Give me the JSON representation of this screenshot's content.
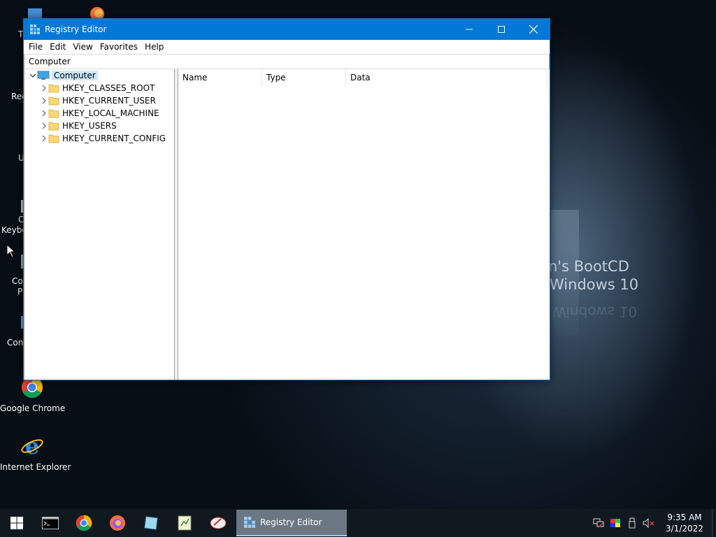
{
  "window": {
    "title": "Registry Editor",
    "menu": [
      "File",
      "Edit",
      "View",
      "Favorites",
      "Help"
    ],
    "address": "Computer",
    "tree": {
      "root": "Computer",
      "children": [
        "HKEY_CLASSES_ROOT",
        "HKEY_CURRENT_USER",
        "HKEY_LOCAL_MACHINE",
        "HKEY_USERS",
        "HKEY_CURRENT_CONFIG"
      ]
    },
    "columns": [
      "Name",
      "Type",
      "Data"
    ]
  },
  "desktop": {
    "icons": [
      {
        "label": "Google Chrome",
        "icon": "chrome-icon"
      },
      {
        "label": "Internet Explorer",
        "icon": "internet-explorer-icon"
      }
    ],
    "partial_labels": [
      "T",
      "Rec",
      "U",
      "C",
      "Keybo",
      "Co",
      "P",
      "Conf"
    ],
    "brand_line1": "n's BootCD",
    "brand_line2": "Windows 10",
    "brand_reflection": "Windows 10"
  },
  "taskbar": {
    "active_app": "Registry Editor",
    "pinned": [
      "start-icon",
      "command-prompt-icon",
      "chrome-icon",
      "firefox-icon",
      "explorer-icon",
      "notepad-icon",
      "paint-icon"
    ],
    "tray": [
      "network-icon",
      "display-color-icon",
      "usb-icon",
      "volume-muted-icon"
    ],
    "time": "9:35 AM",
    "date": "3/1/2022"
  },
  "colors": {
    "titlebar": "#0078d7",
    "selection": "#cce8ff",
    "taskbar": "#101820"
  }
}
